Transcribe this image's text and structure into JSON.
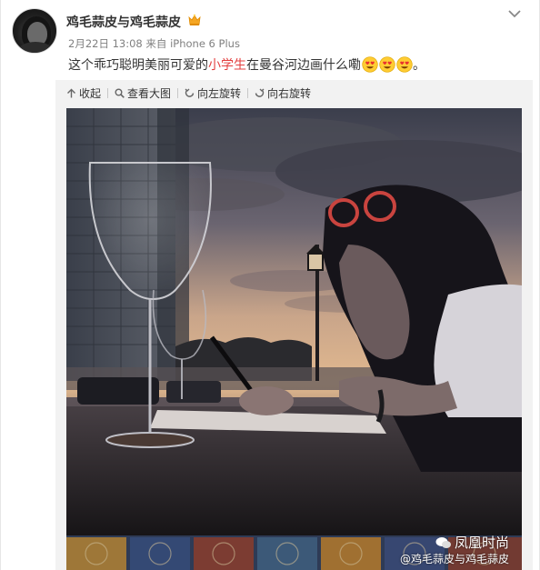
{
  "user": {
    "name": "鸡毛蒜皮与鸡毛蒜皮",
    "vip_icon": "vip-badge-icon"
  },
  "meta": {
    "date": "2月22日",
    "time": "13:08",
    "source_prefix": "来自",
    "source": "iPhone 6 Plus"
  },
  "post": {
    "text_before": "这个乖巧聪明美丽可爱的",
    "highlight": "小学生",
    "text_after": "在曼谷河边画什么嘞",
    "ending": "。",
    "emoji": [
      "heart-eyes-emoji",
      "heart-eyes-emoji",
      "heart-eyes-emoji"
    ]
  },
  "toolbar": {
    "collapse": "收起",
    "view_large": "查看大图",
    "rotate_left": "向左旋转",
    "rotate_right": "向右旋转"
  },
  "image": {
    "watermark_brand": "凤凰时尚",
    "watermark_user": "@鸡毛蒜皮与鸡毛蒜皮"
  },
  "colors": {
    "highlight": "#e33f3f",
    "meta_text": "#808080",
    "media_bg": "#f2f2f2",
    "vip": "#f5a623"
  }
}
